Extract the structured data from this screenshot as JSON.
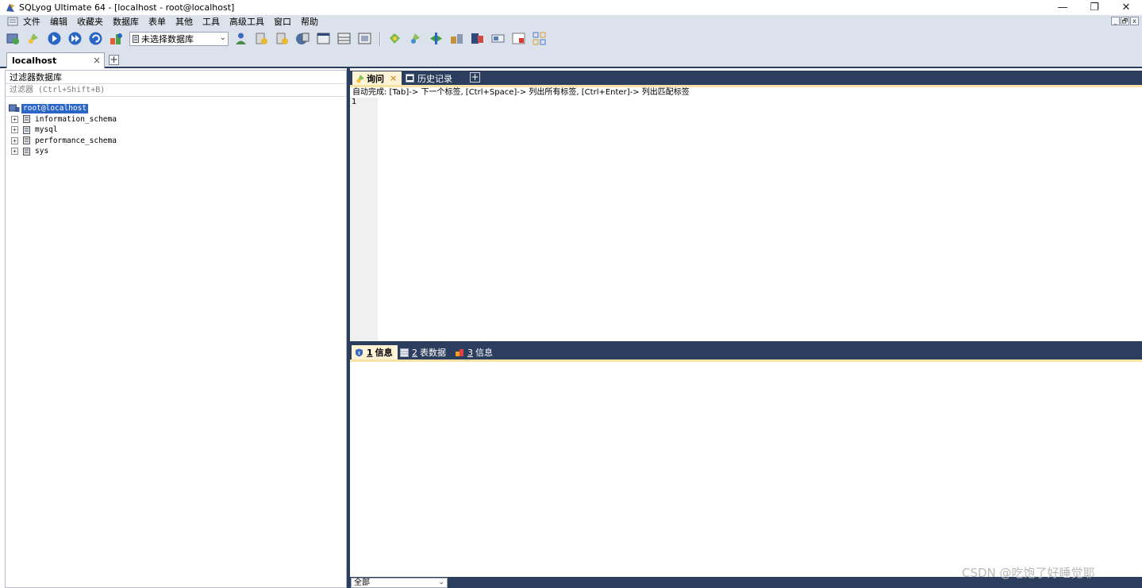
{
  "window": {
    "title": "SQLyog Ultimate 64 - [localhost - root@localhost]",
    "controls": {
      "minimize": "—",
      "restore": "❐",
      "close": "✕"
    }
  },
  "menu": {
    "items": [
      "文件",
      "编辑",
      "收藏夹",
      "数据库",
      "表单",
      "其他",
      "工具",
      "高级工具",
      "窗口",
      "帮助"
    ],
    "mdi_controls": [
      "_",
      "🗗",
      "x"
    ]
  },
  "toolbar": {
    "db_selector": {
      "value": "未选择数据库"
    }
  },
  "connection_tabs": [
    {
      "label": "localhost",
      "close": "×"
    }
  ],
  "connection_tab_add": "+",
  "object_browser": {
    "title": "过滤器数据库",
    "filter_placeholder": "过滤器 (Ctrl+Shift+B)",
    "root": "root@localhost",
    "databases": [
      "information_schema",
      "mysql",
      "performance_schema",
      "sys"
    ],
    "expander": "+"
  },
  "query_tabs": {
    "query": {
      "label": "询问",
      "close": "×"
    },
    "history": {
      "label": "历史记录"
    },
    "add": "+"
  },
  "editor": {
    "autocomplete_hint": "自动完成: [Tab]-> 下一个标签, [Ctrl+Space]-> 列出所有标签, [Ctrl+Enter]-> 列出匹配标签",
    "line_numbers": [
      "1"
    ]
  },
  "result_tabs": [
    {
      "num": "1",
      "label": "信息"
    },
    {
      "num": "2",
      "label": "表数据"
    },
    {
      "num": "3",
      "label": "信息"
    }
  ],
  "bottom": {
    "filter_value": "全部"
  },
  "watermark": "CSDN @吃饱了好睡觉耶",
  "colors": {
    "dark_navy": "#2c3e5e",
    "toolbar_bg": "#dce2ec",
    "active_tab": "#fff3d6",
    "selection": "#2a66c6"
  }
}
